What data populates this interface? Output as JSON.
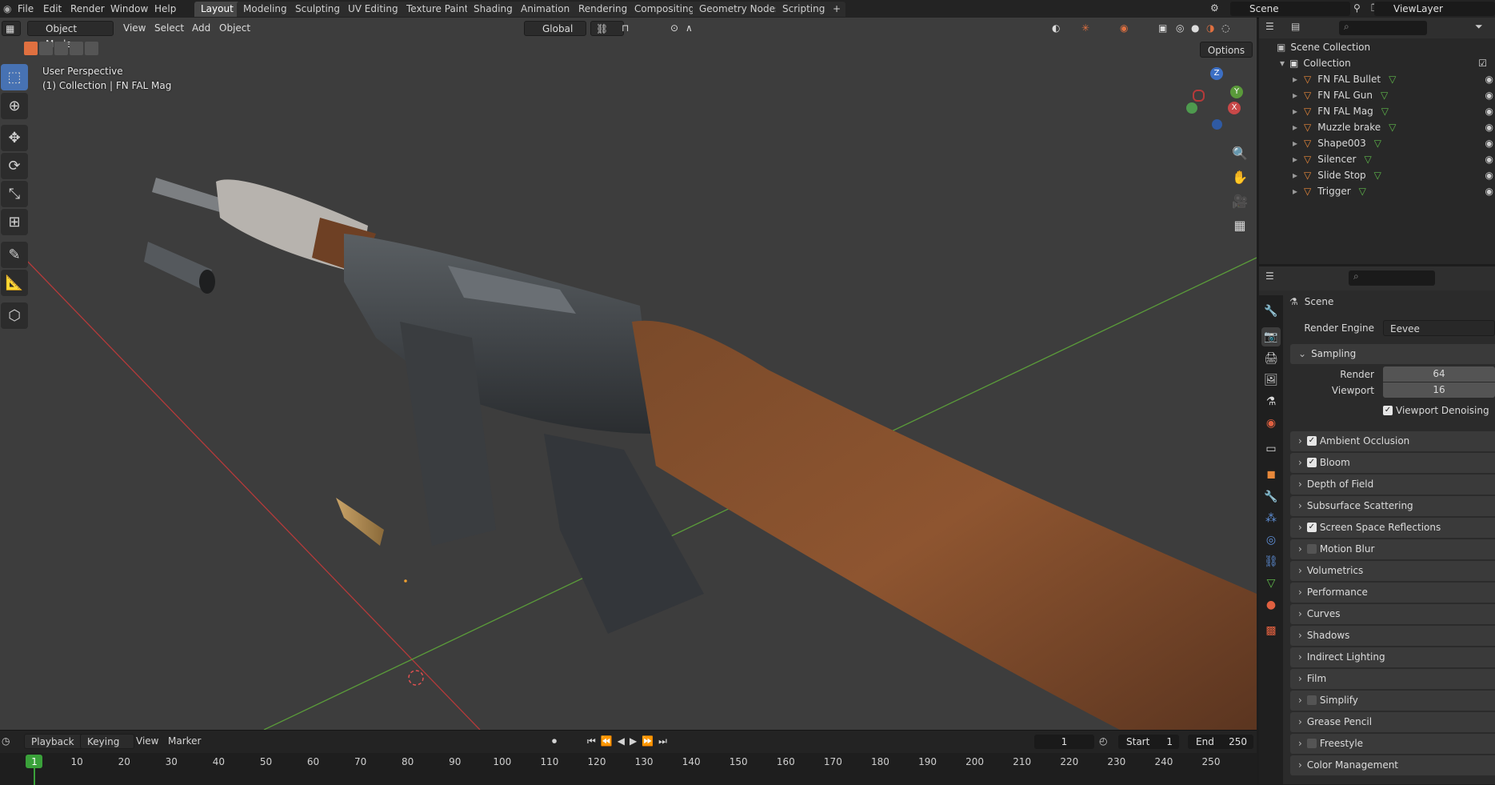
{
  "menu": [
    "File",
    "Edit",
    "Render",
    "Window",
    "Help"
  ],
  "workspaces": [
    "Layout",
    "Modeling",
    "Sculpting",
    "UV Editing",
    "Texture Paint",
    "Shading",
    "Animation",
    "Rendering",
    "Compositing",
    "Geometry Nodes",
    "Scripting"
  ],
  "add_workspace": "+",
  "scene_field": "Scene",
  "viewlayer_field": "ViewLayer",
  "viewport": {
    "mode": "Object Mode",
    "menus": [
      "View",
      "Select",
      "Add",
      "Object"
    ],
    "orientation": "Global",
    "options": "Options",
    "perspective_label": "User Perspective",
    "collection_label": "(1) Collection | FN FAL Mag",
    "gizmo": {
      "x": "X",
      "y": "Y",
      "z": "Z"
    }
  },
  "outliner": {
    "scene_collection": "Scene Collection",
    "collection": "Collection",
    "objects": [
      "FN FAL Bullet",
      "FN FAL Gun",
      "FN FAL Mag",
      "Muzzle brake",
      "Shape003",
      "Silencer",
      "Slide Stop",
      "Trigger"
    ]
  },
  "properties": {
    "context": "Scene",
    "render_engine_label": "Render Engine",
    "render_engine": "Eevee",
    "sampling_title": "Sampling",
    "render_label": "Render",
    "render_value": "64",
    "viewport_label": "Viewport",
    "viewport_value": "16",
    "viewport_denoising": "Viewport Denoising",
    "panels": [
      {
        "label": "Ambient Occlusion",
        "checkbox": true,
        "checked": true
      },
      {
        "label": "Bloom",
        "checkbox": true,
        "checked": true
      },
      {
        "label": "Depth of Field",
        "checkbox": false
      },
      {
        "label": "Subsurface Scattering",
        "checkbox": false
      },
      {
        "label": "Screen Space Reflections",
        "checkbox": true,
        "checked": true
      },
      {
        "label": "Motion Blur",
        "checkbox": true,
        "checked": false
      },
      {
        "label": "Volumetrics",
        "checkbox": false
      },
      {
        "label": "Performance",
        "checkbox": false
      },
      {
        "label": "Curves",
        "checkbox": false
      },
      {
        "label": "Shadows",
        "checkbox": false
      },
      {
        "label": "Indirect Lighting",
        "checkbox": false
      },
      {
        "label": "Film",
        "checkbox": false
      },
      {
        "label": "Simplify",
        "checkbox": true,
        "checked": false
      },
      {
        "label": "Grease Pencil",
        "checkbox": false
      },
      {
        "label": "Freestyle",
        "checkbox": true,
        "checked": false
      },
      {
        "label": "Color Management",
        "checkbox": false
      }
    ]
  },
  "timeline": {
    "menus": [
      "Playback",
      "Keying",
      "View",
      "Marker"
    ],
    "current_frame": "1",
    "start_label": "Start",
    "start": "1",
    "end_label": "End",
    "end": "250",
    "ruler": [
      "1",
      "10",
      "20",
      "30",
      "40",
      "50",
      "60",
      "70",
      "80",
      "90",
      "100",
      "110",
      "120",
      "130",
      "140",
      "150",
      "160",
      "170",
      "180",
      "190",
      "200",
      "210",
      "220",
      "230",
      "240",
      "250"
    ]
  },
  "colors": {
    "accent": "#4772b3",
    "x_axis": "#b53a3a",
    "y_axis": "#5a9a3a",
    "z_axis": "#3c6fc4",
    "object_icon": "#e8883a",
    "frame": "#3aa13a"
  }
}
